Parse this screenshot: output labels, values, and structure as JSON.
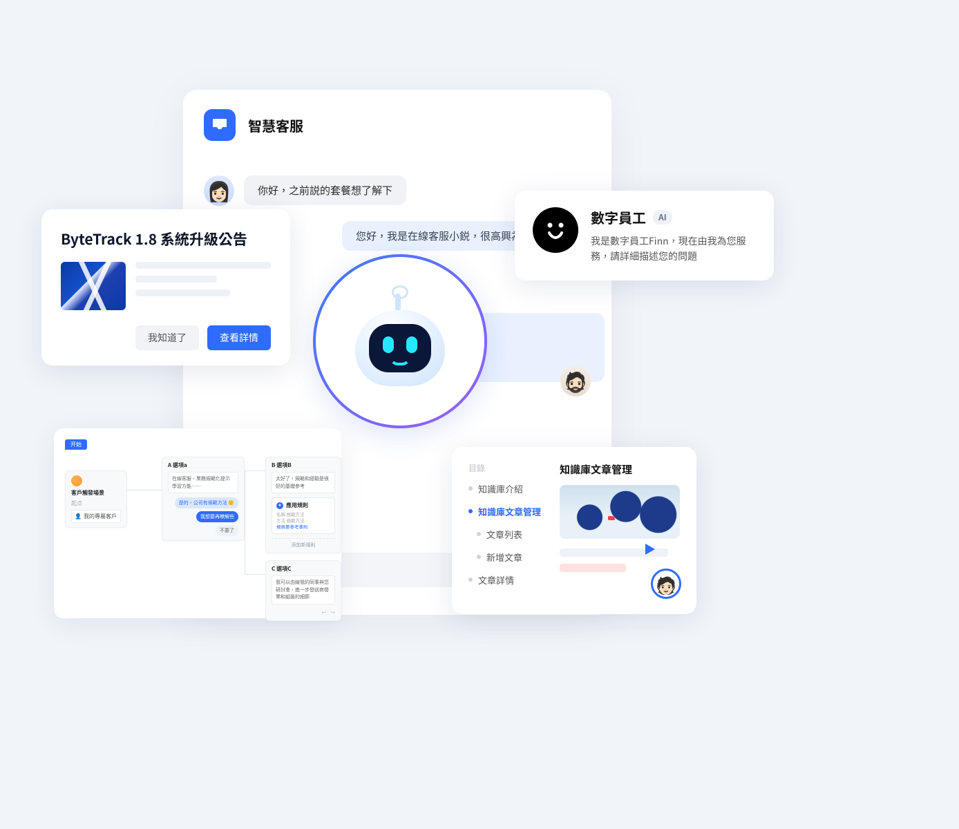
{
  "chat": {
    "title": "智慧客服",
    "user_msg": "你好，之前説的套餐想了解下",
    "agent_msg": "您好，我是在線客服小鋭，很高興為您提供"
  },
  "announce": {
    "title": "ByteTrack 1.8 系統升級公告",
    "ack_label": "我知道了",
    "cta_label": "查看詳情"
  },
  "digital_employee": {
    "title": "數字員工",
    "badge": "AI",
    "desc": "我是數字員工Finn，現在由我為您服務，請詳細描述您的問題"
  },
  "kb": {
    "toc_label": "目錄",
    "content_title": "知識庫文章管理",
    "items": [
      {
        "label": "知識庫介紹",
        "sub": false,
        "active": false
      },
      {
        "label": "知識庫文章管理",
        "sub": false,
        "active": true
      },
      {
        "label": "文章列表",
        "sub": true,
        "active": false
      },
      {
        "label": "新增文章",
        "sub": true,
        "active": false
      },
      {
        "label": "文章詳情",
        "sub": false,
        "active": false
      }
    ]
  },
  "flow": {
    "tag": "开始",
    "start": {
      "title": "客戶觸發場景",
      "field_label": "我的專屬客戶"
    },
    "node_a": {
      "title": "A 選項a",
      "body": "在線客服，業務規範化提示學習方能……",
      "chip1": "是的，公司有規範方法",
      "chip2": "我想要再瞭解些",
      "chip3": "不要了"
    },
    "node_b": {
      "title": "B 選項B",
      "body": "太好了，規範和經驗是很好的基礎參考",
      "rule_title": "應用規則",
      "meta1": "名稱  規範方法",
      "meta2": "方法  規範方法",
      "meta3": "規格要參考準則",
      "foot": "添加新規則"
    },
    "node_c": {
      "title": "C 選項C",
      "body": "我可以由線我的同事與您研討會，進一步發送商營業和組裝的細節"
    }
  }
}
